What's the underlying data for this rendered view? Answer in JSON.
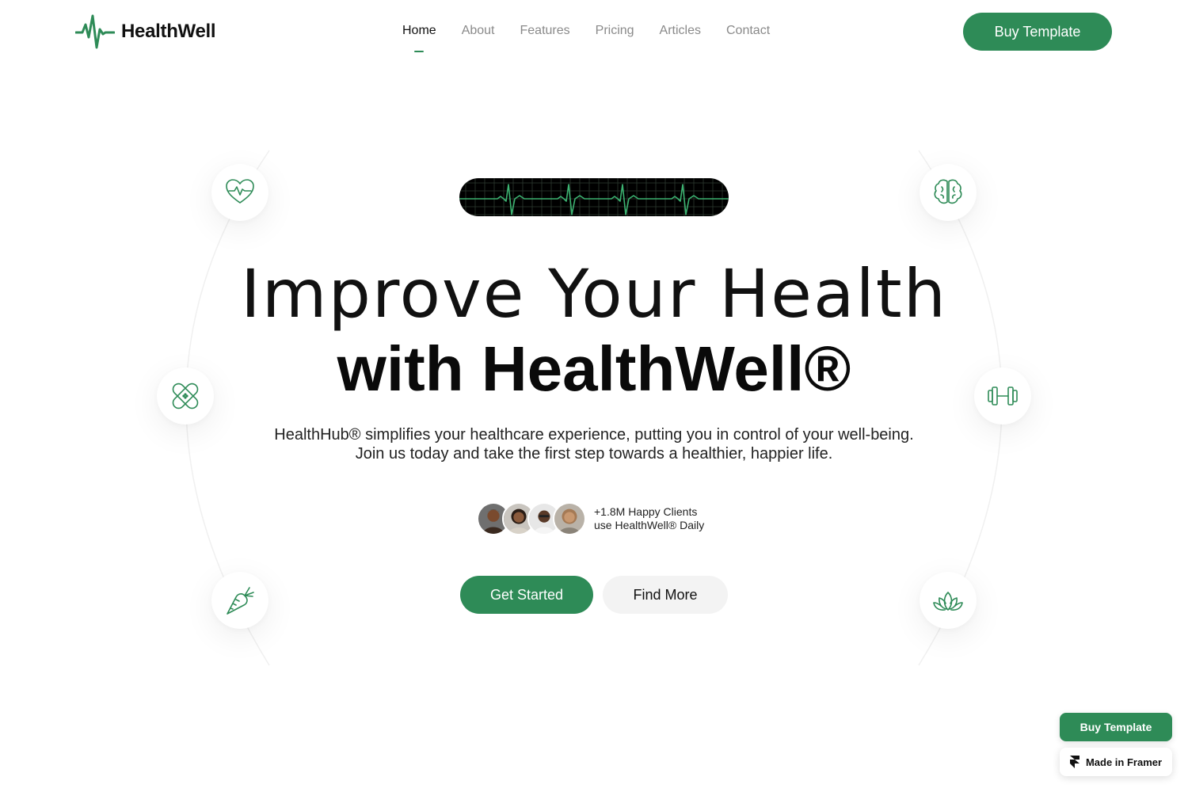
{
  "brand": {
    "name": "HealthWell",
    "accent": "#2e8b57",
    "logo_icon": "heartbeat-pulse-icon"
  },
  "nav": {
    "items": [
      {
        "label": "Home",
        "active": true
      },
      {
        "label": "About",
        "active": false
      },
      {
        "label": "Features",
        "active": false
      },
      {
        "label": "Pricing",
        "active": false
      },
      {
        "label": "Articles",
        "active": false
      },
      {
        "label": "Contact",
        "active": false
      }
    ],
    "cta_label": "Buy Template"
  },
  "hero": {
    "banner_icon": "ecg-monitor-icon",
    "title_line1": "Improve Your Health",
    "title_line2": "with HealthWell®",
    "subtitle_line1": "HealthHub® simplifies your healthcare experience, putting you in control of your well-being.",
    "subtitle_line2": "Join us today and take the first step towards a healthier, happier life.",
    "clients_line1": "+1.8M Happy Clients",
    "clients_line2": "use HealthWell® Daily",
    "primary_cta": "Get Started",
    "secondary_cta": "Find More"
  },
  "orbit_icons": [
    "heart-pulse-icon",
    "brain-icon",
    "bandage-icon",
    "dumbbell-icon",
    "carrot-icon",
    "lotus-icon"
  ],
  "floating": {
    "buy_label": "Buy Template",
    "framer_label": "Made in Framer"
  }
}
